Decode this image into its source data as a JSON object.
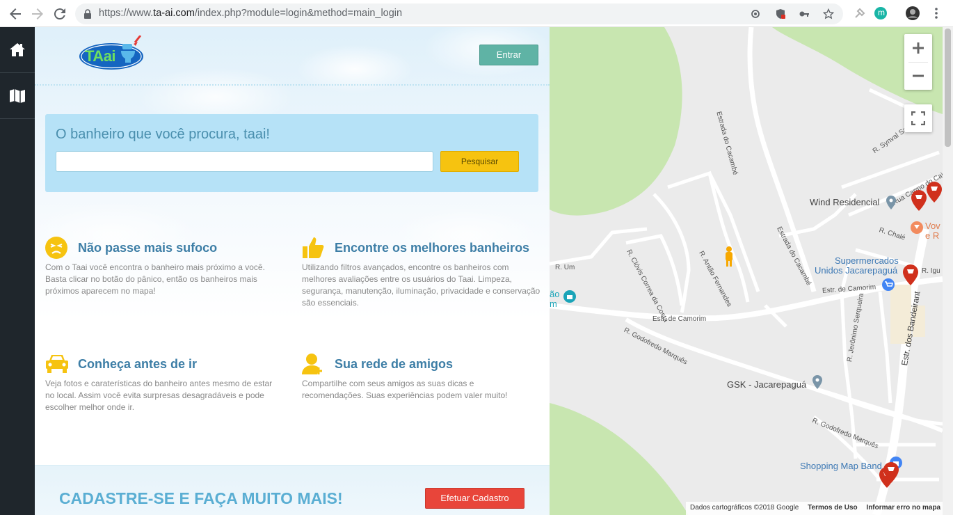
{
  "browser": {
    "url_prefix": "https://www.",
    "url_domain": "ta-ai.com",
    "url_path": "/index.php?module=login&method=main_login",
    "extension_badge": "m"
  },
  "sidebar": {
    "items": [
      {
        "icon": "home-icon"
      },
      {
        "icon": "map-icon"
      }
    ]
  },
  "header": {
    "logo_text": "TAai",
    "login_label": "Entrar"
  },
  "search": {
    "title": "O banheiro que você procura, taai!",
    "value": "",
    "button_label": "Pesquisar"
  },
  "features": [
    {
      "icon": "face-icon",
      "title": "Não passe mais sufoco",
      "text": "Com o Taai você encontra o banheiro mais próximo a você. Basta clicar no botão do pânico, então os banheiros mais próximos aparecem no mapa!"
    },
    {
      "icon": "thumbs-up-icon",
      "title": "Encontre os melhores banheiros",
      "text": "Utilizando filtros avançados, encontre os banheiros com melhores avaliações entre os usuários do Taai. Limpeza, segurança, manutenção, iluminação, privacidade e conservação são essenciais."
    },
    {
      "icon": "car-icon",
      "title": "Conheça antes de ir",
      "text": "Veja fotos e caraterísticas do banheiro antes mesmo de estar no local. Assim você evita surpresas desagradáveis e pode escolher melhor onde ir."
    },
    {
      "icon": "add-user-icon",
      "title": "Sua rede de amigos",
      "text": "Compartilhe com seus amigos as suas dicas e recomendações. Suas experiências podem valer muito!"
    }
  ],
  "footer": {
    "cta": "CADASTRE-SE E FAÇA MUITO MAIS!",
    "signup_label": "Efetuar Cadastro"
  },
  "map": {
    "streets": [
      "Estrada do Cacambé",
      "R. Synval Sam",
      "Rua Carmo do Cajur",
      "R. Chalé",
      "R. Um",
      "R. Clóvis Correa da Costa",
      "R. Antão Fernandes",
      "Estrada do Cacambé",
      "Estr. de Camorim",
      "Estr. de Camorim",
      "R. Godofredo Marquês",
      "R. Jerônimo Serqueira",
      "Estr. dos Bandeirant",
      "R. Godofredo Marquês",
      "R. Igu"
    ],
    "places": {
      "wind": "Wind Residencial",
      "super": "Supermercados",
      "super2": "Unidos Jacarepaguá",
      "gsk": "GSK - Jacarepaguá",
      "shopping": "Shopping Map Band",
      "vov1": "Vov",
      "vov2": "e R",
      "left1": "ão",
      "left2": "m"
    },
    "attribution": {
      "data": "Dados cartográficos ©2018 Google",
      "terms": "Termos de Uso",
      "report": "Informar erro no mapa"
    }
  }
}
